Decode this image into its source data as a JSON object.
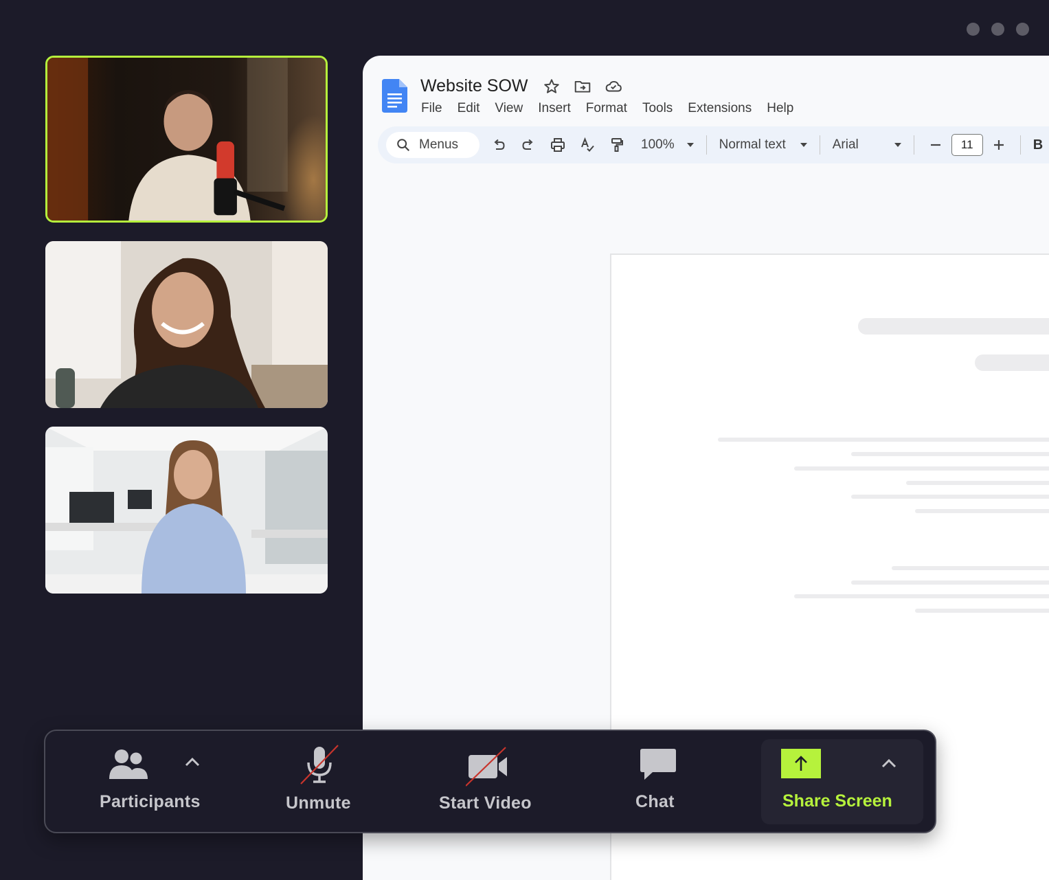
{
  "window": {
    "controls": [
      "dot",
      "dot",
      "dot"
    ]
  },
  "participants_tiles": [
    {
      "name": "speaker-tile",
      "active": true
    },
    {
      "name": "participant-tile"
    },
    {
      "name": "participant-tile"
    }
  ],
  "docs": {
    "title": "Website SOW",
    "menu": [
      "File",
      "Edit",
      "View",
      "Insert",
      "Format",
      "Tools",
      "Extensions",
      "Help"
    ],
    "toolbar": {
      "search_label": "Menus",
      "zoom": "100%",
      "style": "Normal text",
      "font": "Arial",
      "font_size": "11",
      "bold": "B"
    }
  },
  "meeting_controls": {
    "participants": "Participants",
    "unmute": "Unmute",
    "start_video": "Start Video",
    "chat": "Chat",
    "share_screen": "Share Screen"
  },
  "colors": {
    "background": "#1c1b29",
    "accent": "#b6f23c",
    "docs_blue": "#4285f4",
    "muted_red": "#c8342c"
  }
}
